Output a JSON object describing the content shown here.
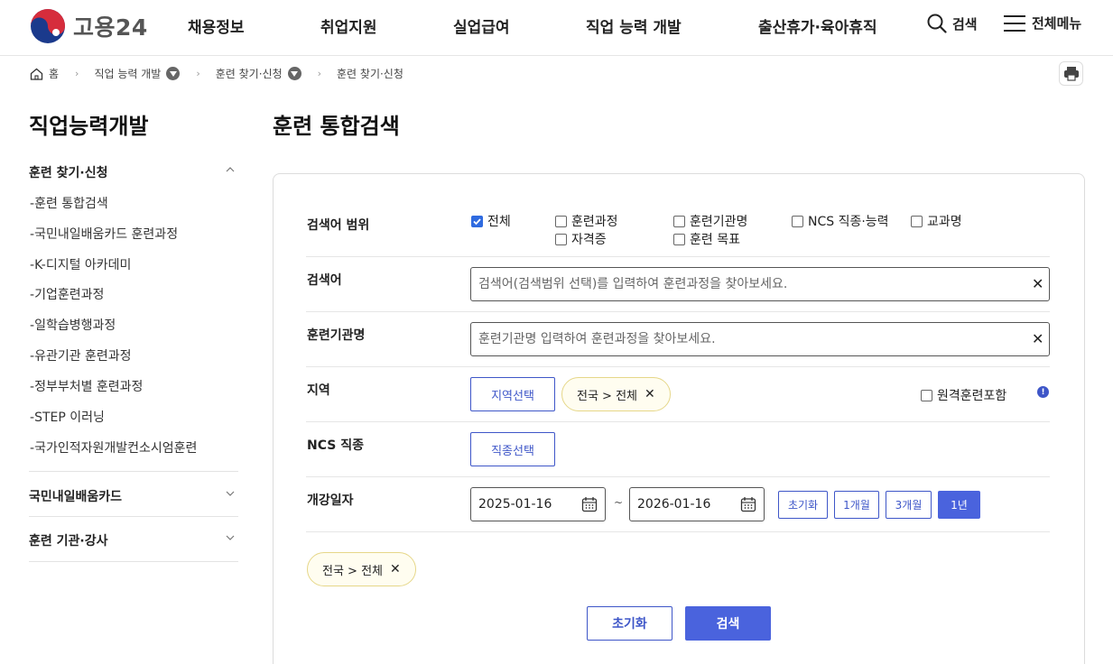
{
  "header": {
    "logo_text": "고용24",
    "nav": [
      "채용정보",
      "취업지원",
      "실업급여",
      "직업 능력 개발",
      "출산휴가·육아휴직"
    ],
    "search_label": "검색",
    "menu_label": "전체메뉴"
  },
  "breadcrumb": {
    "home": "홈",
    "items": [
      "직업 능력 개발",
      "훈련 찾기·신청",
      "훈련 찾기·신청"
    ]
  },
  "sidebar": {
    "title": "직업능력개발",
    "group1": "훈련 찾기·신청",
    "sub_items": [
      "훈련 통합검색",
      "국민내일배움카드 훈련과정",
      "K-디지털 아카데미",
      "기업훈련과정",
      "일학습병행과정",
      "유관기관 훈련과정",
      "정부부처별 훈련과정",
      "STEP 이러닝",
      "국가인적자원개발컨소시엄훈련"
    ],
    "group2": "국민내일배움카드",
    "group3": "훈련 기관·강사"
  },
  "main": {
    "title": "훈련 통합검색",
    "scope": {
      "label": "검색어 범위",
      "options": [
        {
          "label": "전체",
          "checked": true
        },
        {
          "label": "훈련과정",
          "checked": false
        },
        {
          "label": "훈련기관명",
          "checked": false
        },
        {
          "label": "NCS 직종·능력",
          "checked": false
        },
        {
          "label": "교과명",
          "checked": false
        },
        {
          "label": "자격증",
          "checked": false
        },
        {
          "label": "훈련 목표",
          "checked": false
        }
      ]
    },
    "keyword": {
      "label": "검색어",
      "placeholder": "검색어(검색범위 선택)를 입력하여 훈련과정을 찾아보세요."
    },
    "institution": {
      "label": "훈련기관명",
      "placeholder": "훈련기관명 입력하여 훈련과정을 찾아보세요."
    },
    "region": {
      "label": "지역",
      "button": "지역선택",
      "chip": "전국 > 전체",
      "remote_label": "원격훈련포함",
      "info": "!"
    },
    "ncs": {
      "label": "NCS 직종",
      "button": "직종선택"
    },
    "date": {
      "label": "개강일자",
      "start": "2025-01-16",
      "end": "2026-01-16",
      "tilde": "~",
      "periods": [
        "초기화",
        "1개월",
        "3개월",
        "1년"
      ],
      "active_period": "1년"
    },
    "selected_chip": "전국 > 전체",
    "reset_button": "초기화",
    "search_button": "검색"
  },
  "colors": {
    "accent": "#4a63dd",
    "chip_border": "#e6d789",
    "chip_bg": "#fffdf0"
  }
}
